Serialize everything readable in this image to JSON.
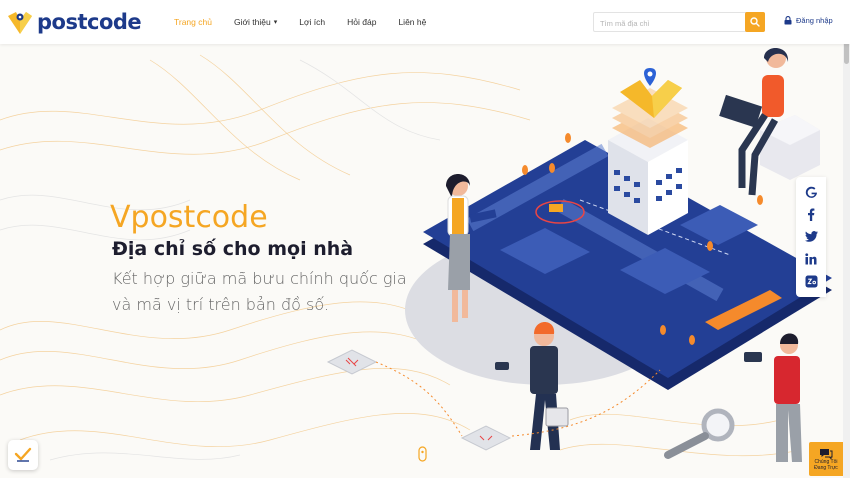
{
  "header": {
    "logo_text": "postcode",
    "nav": [
      {
        "label": "Trang chủ",
        "active": true
      },
      {
        "label": "Giới thiệu",
        "active": false,
        "has_dropdown": true
      },
      {
        "label": "Lợi ích",
        "active": false
      },
      {
        "label": "Hỏi đáp",
        "active": false
      },
      {
        "label": "Liên hệ",
        "active": false
      }
    ],
    "search_placeholder": "Tìm mã địa chỉ",
    "login_label": "Đăng nhập"
  },
  "hero": {
    "title": "Vpostcode",
    "subtitle": "Địa chỉ số cho mọi nhà",
    "description": "Kết hợp giữa mã bưu chính quốc gia và mã vị trí trên bản đồ số."
  },
  "social": [
    "google-icon",
    "facebook-icon",
    "twitter-icon",
    "linkedin-icon",
    "zalo-icon"
  ],
  "chat": {
    "line1": "Chúng Tôi",
    "line2": "Đang Trực"
  },
  "colors": {
    "accent": "#f5a623",
    "brand": "#1d3a8a",
    "platform": "#1f3a8f"
  }
}
